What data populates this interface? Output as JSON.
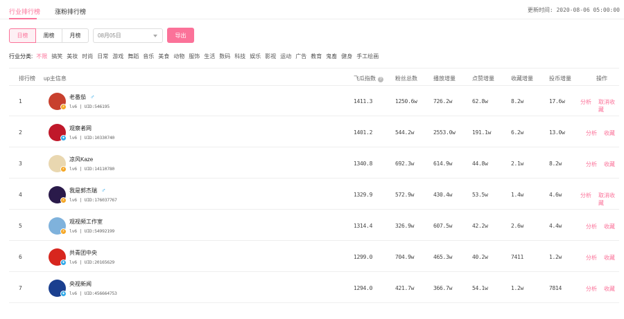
{
  "tabs": [
    {
      "label": "行业排行榜",
      "active": true
    },
    {
      "label": "涨粉排行榜",
      "active": false
    }
  ],
  "update_time": "更新时间: 2020-08-06 05:00:00",
  "period_buttons": [
    {
      "label": "日榜",
      "active": true
    },
    {
      "label": "周榜",
      "active": false
    },
    {
      "label": "月榜",
      "active": false
    }
  ],
  "date_value": "08月05日",
  "export_label": "导出",
  "category_label": "行业分类:",
  "categories": [
    "不限",
    "搞笑",
    "美妆",
    "时尚",
    "日常",
    "游戏",
    "舞蹈",
    "音乐",
    "美食",
    "动物",
    "服饰",
    "生活",
    "数码",
    "科技",
    "娱乐",
    "影视",
    "运动",
    "广告",
    "教育",
    "鬼畜",
    "健身",
    "手工绘画"
  ],
  "active_category": 0,
  "columns": {
    "rank": "排行榜",
    "info": "up主信息",
    "index": "飞瓜指数",
    "fans": "粉丝总数",
    "plays": "播放增量",
    "likes": "点赞增量",
    "favs": "收藏增量",
    "coins": "投币增量",
    "ops": "操作"
  },
  "rows": [
    {
      "rank": "1",
      "name": "老番茄",
      "male": true,
      "level_uid": "lv6 | UID:546195",
      "index": "1411.3",
      "fans": "1250.6w",
      "plays": "726.2w",
      "likes": "62.8w",
      "favs": "8.2w",
      "coins": "17.6w",
      "act1": "分析",
      "act2": "取消收藏",
      "avatar_color": "#c8402e",
      "badge": "gold"
    },
    {
      "rank": "2",
      "name": "观察者网",
      "male": false,
      "level_uid": "lv6 | UID:10330740",
      "index": "1401.2",
      "fans": "544.2w",
      "plays": "2553.0w",
      "likes": "191.1w",
      "favs": "6.2w",
      "coins": "13.0w",
      "act1": "分析",
      "act2": "收藏",
      "avatar_color": "#c0182a",
      "badge": "blue"
    },
    {
      "rank": "3",
      "name": "凉风Kaze",
      "male": false,
      "level_uid": "lv6 | UID:14110780",
      "index": "1340.8",
      "fans": "692.3w",
      "plays": "614.9w",
      "likes": "44.8w",
      "favs": "2.1w",
      "coins": "8.2w",
      "act1": "分析",
      "act2": "收藏",
      "avatar_color": "#e9d7b0",
      "badge": "gold"
    },
    {
      "rank": "4",
      "name": "我是郭杰瑞",
      "male": true,
      "level_uid": "lv6 | UID:176037767",
      "index": "1329.9",
      "fans": "572.9w",
      "plays": "430.4w",
      "likes": "53.5w",
      "favs": "1.4w",
      "coins": "4.6w",
      "act1": "分析",
      "act2": "取消收藏",
      "avatar_color": "#2a1a4a",
      "badge": "gold"
    },
    {
      "rank": "5",
      "name": "观视频工作室",
      "male": false,
      "level_uid": "lv6 | UID:54992199",
      "index": "1314.4",
      "fans": "326.9w",
      "plays": "607.5w",
      "likes": "42.2w",
      "favs": "2.6w",
      "coins": "4.4w",
      "act1": "分析",
      "act2": "收藏",
      "avatar_color": "#7fb2dc",
      "badge": "gold"
    },
    {
      "rank": "6",
      "name": "共青团中央",
      "male": false,
      "level_uid": "lv6 | UID:20165629",
      "index": "1299.0",
      "fans": "704.9w",
      "plays": "465.3w",
      "likes": "40.2w",
      "favs": "7411",
      "coins": "1.2w",
      "act1": "分析",
      "act2": "收藏",
      "avatar_color": "#d7261e",
      "badge": "blue"
    },
    {
      "rank": "7",
      "name": "央视新闻",
      "male": false,
      "level_uid": "lv6 | UID:456664753",
      "index": "1294.0",
      "fans": "421.7w",
      "plays": "366.7w",
      "likes": "54.1w",
      "favs": "1.2w",
      "coins": "7814",
      "act1": "分析",
      "act2": "收藏",
      "avatar_color": "#1a3f8f",
      "badge": "blue"
    }
  ],
  "colors": {
    "accent": "#fb7299",
    "male": "#2fa8e8"
  }
}
